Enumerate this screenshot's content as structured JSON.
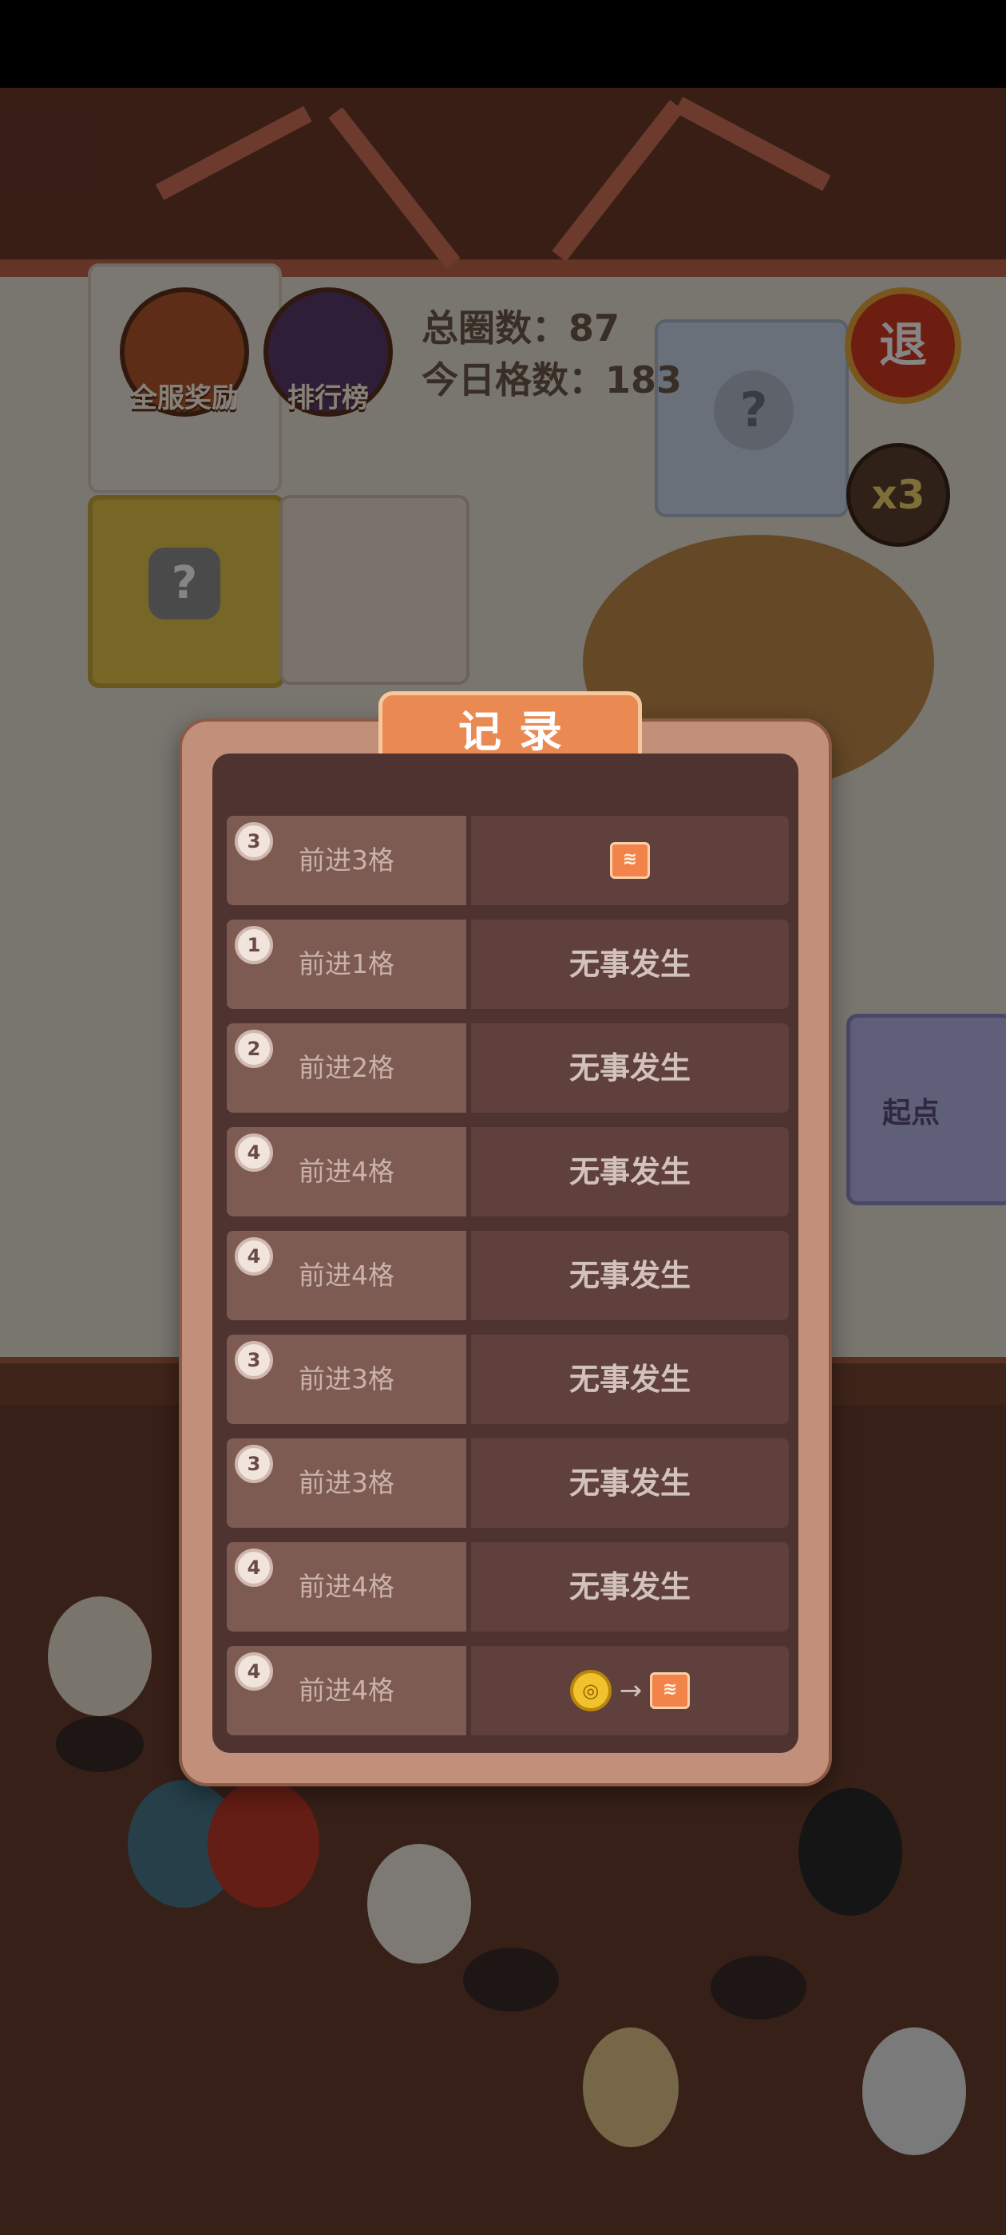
{
  "hud": {
    "rewards_label": "全服奖励",
    "ranking_label": "排行榜",
    "total_laps": "总圈数：87",
    "today_cells": "今日格数：183",
    "exit_label": "退",
    "multiplier": "x3",
    "unknown_mark": "?",
    "start_label": "起点"
  },
  "modal": {
    "title": "记录",
    "rows": [
      {
        "step": "3",
        "move": "前进3格",
        "result": "",
        "icons": [
          "tile-icon"
        ]
      },
      {
        "step": "1",
        "move": "前进1格",
        "result": "无事发生",
        "icons": []
      },
      {
        "step": "2",
        "move": "前进2格",
        "result": "无事发生",
        "icons": []
      },
      {
        "step": "4",
        "move": "前进4格",
        "result": "无事发生",
        "icons": []
      },
      {
        "step": "4",
        "move": "前进4格",
        "result": "无事发生",
        "icons": []
      },
      {
        "step": "3",
        "move": "前进3格",
        "result": "无事发生",
        "icons": []
      },
      {
        "step": "3",
        "move": "前进3格",
        "result": "无事发生",
        "icons": []
      },
      {
        "step": "4",
        "move": "前进4格",
        "result": "无事发生",
        "icons": []
      },
      {
        "step": "4",
        "move": "前进4格",
        "result": "",
        "icons": [
          "coin-icon",
          "arrow-icon",
          "tile-icon"
        ]
      }
    ]
  },
  "colors": {
    "accent": "#ea8a52",
    "panel": "#4e3331",
    "frame": "#c2907a"
  }
}
